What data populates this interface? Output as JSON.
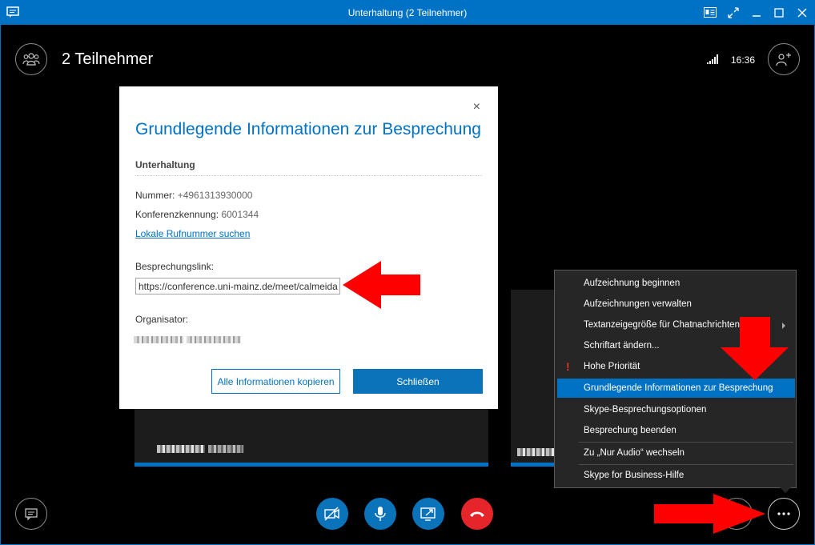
{
  "window": {
    "title": "Unterhaltung (2 Teilnehmer)"
  },
  "header": {
    "participants_label": "2 Teilnehmer",
    "time": "16:36"
  },
  "dialog": {
    "title": "Grundlegende Informationen zur Besprechung",
    "close_symbol": "×",
    "section_title": "Unterhaltung",
    "number_label": "Nummer:",
    "number_value": "+4961313930000",
    "conference_id_label": "Konferenzkennung:",
    "conference_id_value": "6001344",
    "local_number_link": "Lokale Rufnummer suchen",
    "meeting_link_label": "Besprechungslink:",
    "meeting_link_value": "https://conference.uni-mainz.de/meet/calmeida",
    "organizer_label": "Organisator:",
    "copy_button": "Alle Informationen kopieren",
    "close_button": "Schließen"
  },
  "menu": {
    "items": [
      {
        "label": "Aufzeichnung beginnen"
      },
      {
        "label": "Aufzeichnungen verwalten"
      },
      {
        "label": "Textanzeigegröße für Chatnachrichten"
      },
      {
        "label": "Schriftart ändern..."
      },
      {
        "label": "Hohe Priorität",
        "icon": "exclamation-icon"
      },
      {
        "label": "Grundlegende Informationen zur Besprechung",
        "selected": true
      },
      {
        "label": "Skype-Besprechungsoptionen"
      },
      {
        "label": "Besprechung beenden"
      },
      {
        "label": "Zu „Nur Audio“ wechseln"
      },
      {
        "label": "Skype for Business-Hilfe"
      }
    ]
  },
  "colors": {
    "titlebar": "#0072c6",
    "accent": "#0072c6",
    "hangup": "#e5252a",
    "annotation_arrow": "#ff0000",
    "menu_bg": "#262626"
  }
}
